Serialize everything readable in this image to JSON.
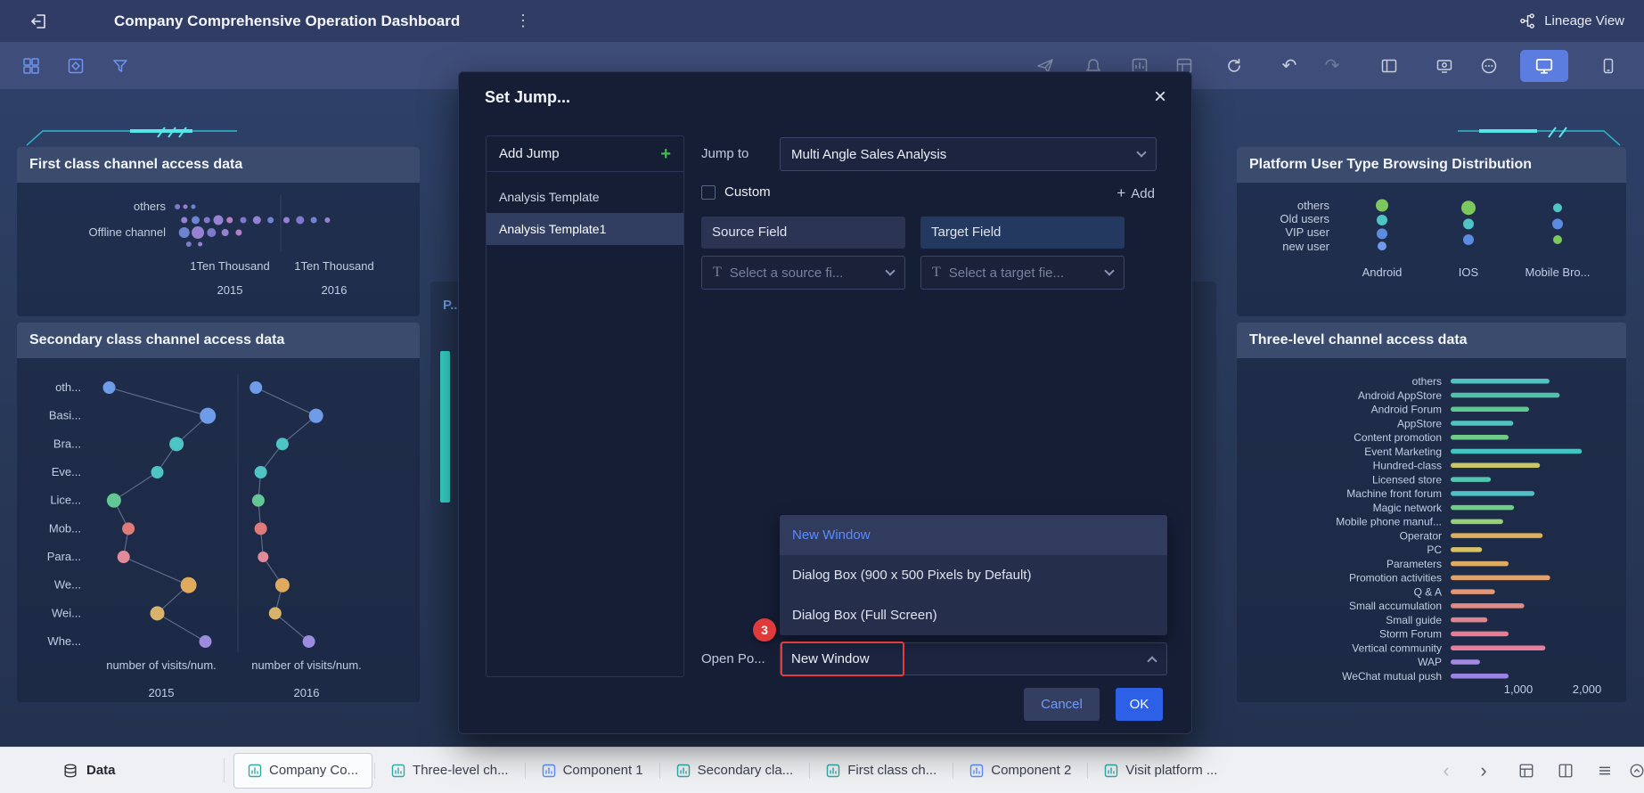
{
  "top_bar": {
    "title": "Company Comprehensive Operation Dashboard",
    "lineage_label": "Lineage View"
  },
  "middle_panel": {
    "title_fragment": "P..."
  },
  "modal": {
    "title": "Set Jump...",
    "panel": {
      "header": "Add Jump",
      "items": [
        {
          "label": "Analysis Template",
          "selected": false
        },
        {
          "label": "Analysis Template1",
          "selected": true
        }
      ]
    },
    "jump_to": {
      "label": "Jump to",
      "value": "Multi Angle Sales Analysis"
    },
    "custom": {
      "label": "Custom",
      "checked": false
    },
    "add_button": "Add",
    "fields": {
      "source_header": "Source Field",
      "target_header": "Target Field",
      "source_placeholder": "Select a source fi...",
      "target_placeholder": "Select a target fie..."
    },
    "open_position": {
      "label": "Open Po...",
      "value": "New Window",
      "options": [
        {
          "label": "New Window",
          "selected": true
        },
        {
          "label": "Dialog Box (900 x 500 Pixels by Default)",
          "selected": false
        },
        {
          "label": "Dialog Box (Full Screen)",
          "selected": false
        }
      ]
    },
    "annotation_step": "3",
    "cancel_label": "Cancel",
    "ok_label": "OK"
  },
  "bottom_bar": {
    "data_label": "Data",
    "tabs": [
      {
        "label": "Company Co...",
        "active": true,
        "icon_color": "#2fa8a8"
      },
      {
        "label": "Three-level ch...",
        "active": false,
        "icon_color": "#2fa8a8"
      },
      {
        "label": "Component 1",
        "active": false,
        "icon_color": "#5b8cff"
      },
      {
        "label": "Secondary cla...",
        "active": false,
        "icon_color": "#2fa8a8"
      },
      {
        "label": "First class ch...",
        "active": false,
        "icon_color": "#2fa8a8"
      },
      {
        "label": "Component 2",
        "active": false,
        "icon_color": "#5b8cff"
      },
      {
        "label": "Visit platform ...",
        "active": false,
        "icon_color": "#2fa8a8"
      }
    ]
  },
  "chart_data": [
    {
      "id": "first_class",
      "type": "strip-scatter",
      "title": "First class channel access data",
      "row_labels": [
        "others",
        "Offline channel"
      ],
      "facets": [
        {
          "axis_label": "1Ten Thousand",
          "year": "2015"
        },
        {
          "axis_label": "1Ten Thousand",
          "year": "2016"
        }
      ],
      "palette": [
        "#8d84e0",
        "#a98de6",
        "#7b8fe6",
        "#c98ad9"
      ],
      "points": [
        [
          0.02,
          0,
          3,
          0
        ],
        [
          0.055,
          0,
          2.5,
          1
        ],
        [
          0.09,
          0,
          2.5,
          2
        ],
        [
          0.05,
          1,
          3.5,
          1
        ],
        [
          0.1,
          1,
          4.5,
          2
        ],
        [
          0.15,
          1,
          3.5,
          0
        ],
        [
          0.2,
          1,
          5.5,
          1
        ],
        [
          0.25,
          1,
          3.5,
          3
        ],
        [
          0.31,
          1,
          3.5,
          0
        ],
        [
          0.37,
          1,
          4.5,
          1
        ],
        [
          0.43,
          1,
          3.5,
          2
        ],
        [
          0.5,
          1,
          3.5,
          1
        ],
        [
          0.56,
          1,
          4.5,
          0
        ],
        [
          0.62,
          1,
          3.5,
          2
        ],
        [
          0.68,
          1,
          3,
          1
        ],
        [
          0.05,
          2,
          6,
          2
        ],
        [
          0.11,
          2,
          7,
          1
        ],
        [
          0.17,
          2,
          5,
          0
        ],
        [
          0.23,
          2,
          4,
          1
        ],
        [
          0.29,
          2,
          3.5,
          3
        ],
        [
          0.07,
          3,
          3,
          0
        ],
        [
          0.12,
          3,
          2.5,
          1
        ]
      ]
    },
    {
      "id": "secondary_class",
      "type": "connected-scatter",
      "title": "Secondary class channel access data",
      "x_axis_label": "number of visits/num.",
      "years": [
        "2015",
        "2016"
      ],
      "categories": [
        {
          "label": "oth...",
          "x2015": 0.05,
          "x2016": 0.66,
          "r2015": 7,
          "r2016": 7,
          "color": "#6f9ce8"
        },
        {
          "label": "Basi...",
          "x2015": 0.46,
          "x2016": 0.91,
          "r2015": 9,
          "r2016": 8,
          "color": "#6f9ce8"
        },
        {
          "label": "Bra...",
          "x2015": 0.33,
          "x2016": 0.77,
          "r2015": 8,
          "r2016": 7,
          "color": "#4ec4c4"
        },
        {
          "label": "Eve...",
          "x2015": 0.25,
          "x2016": 0.68,
          "r2015": 7,
          "r2016": 7,
          "color": "#4ec4c4"
        },
        {
          "label": "Lice...",
          "x2015": 0.07,
          "x2016": 0.67,
          "r2015": 8,
          "r2016": 7,
          "color": "#63c795"
        },
        {
          "label": "Mob...",
          "x2015": 0.13,
          "x2016": 0.68,
          "r2015": 7,
          "r2016": 7,
          "color": "#e07b7b"
        },
        {
          "label": "Para...",
          "x2015": 0.11,
          "x2016": 0.69,
          "r2015": 7,
          "r2016": 6,
          "color": "#e08a9a"
        },
        {
          "label": "We...",
          "x2015": 0.38,
          "x2016": 0.77,
          "r2015": 9,
          "r2016": 8,
          "color": "#dfa95e"
        },
        {
          "label": "Wei...",
          "x2015": 0.25,
          "x2016": 0.74,
          "r2015": 8,
          "r2016": 7,
          "color": "#d9b36a"
        },
        {
          "label": "Whe...",
          "x2015": 0.45,
          "x2016": 0.88,
          "r2015": 7,
          "r2016": 7,
          "color": "#9b8ce0"
        }
      ]
    },
    {
      "id": "platform_user",
      "type": "bubble-columns",
      "title": "Platform User Type Browsing Distribution",
      "row_labels": [
        "others",
        "Old users",
        "VIP user",
        "new user"
      ],
      "columns": [
        {
          "label": "Android",
          "dots": [
            [
              0.1,
              7,
              "#7cc85d"
            ],
            [
              0.4,
              6,
              "#4ec4c4"
            ],
            [
              0.68,
              6,
              "#5b8ce0"
            ],
            [
              0.93,
              5,
              "#6f9ce8"
            ]
          ]
        },
        {
          "label": "IOS",
          "dots": [
            [
              0.15,
              8,
              "#7cc85d"
            ],
            [
              0.48,
              6,
              "#4ec4c4"
            ],
            [
              0.8,
              6,
              "#5b8ce0"
            ]
          ]
        },
        {
          "label": "Mobile Bro...",
          "dots": [
            [
              0.15,
              5,
              "#4ec4c4"
            ],
            [
              0.48,
              6,
              "#5b8ce0"
            ],
            [
              0.8,
              5,
              "#7cc85d"
            ]
          ]
        }
      ]
    },
    {
      "id": "three_level",
      "type": "bar",
      "title": "Three-level channel access data",
      "x_ticks": [
        "1,000",
        "2,000"
      ],
      "x_max": 2000,
      "categories": [
        "others",
        "Android AppStore",
        "Android Forum",
        "AppStore",
        "Content promotion",
        "Event Marketing",
        "Hundred-class",
        "Licensed store",
        "Machine front forum",
        "Magic network",
        "Mobile phone manuf...",
        "Operator",
        "PC",
        "Parameters",
        "Promotion activities",
        "Q & A",
        "Small accumulation",
        "Small guide",
        "Storm Forum",
        "Vertical community",
        "WAP",
        "WeChat mutual push"
      ],
      "values": [
        1450,
        1600,
        1150,
        920,
        850,
        1925,
        1310,
        590,
        1230,
        930,
        770,
        1350,
        460,
        850,
        1460,
        650,
        1080,
        540,
        850,
        1390,
        430,
        850
      ],
      "colors": [
        "#4fc3bd",
        "#4fc3a8",
        "#5cc98f",
        "#4fc3bd",
        "#6ecc89",
        "#45c2c2",
        "#c8c46a",
        "#52c5b1",
        "#52bfc5",
        "#70cc86",
        "#96cf76",
        "#ddb05e",
        "#d8c267",
        "#ddac65",
        "#e0a26f",
        "#e09877",
        "#e08c84",
        "#e0848e",
        "#e67b92",
        "#ea7d9a",
        "#a389df",
        "#9a83e1"
      ]
    }
  ]
}
